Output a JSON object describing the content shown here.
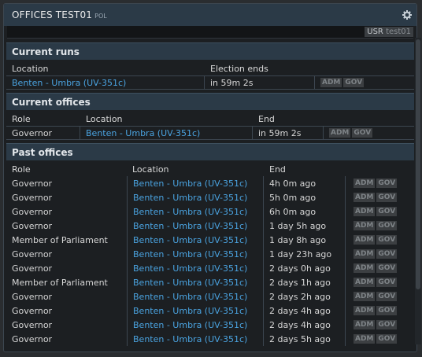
{
  "window": {
    "title": "OFFICES TEST01",
    "tag": "POL",
    "gear_icon": "gear-icon"
  },
  "user": {
    "label": "USR",
    "name": "test01"
  },
  "current_runs": {
    "title": "Current runs",
    "headers": {
      "location": "Location",
      "ends": "Election ends"
    },
    "rows": [
      {
        "location": "Benten - Umbra (UV-351c)",
        "ends": "in 59m 2s",
        "adm": "ADM",
        "gov": "GOV"
      }
    ]
  },
  "current_offices": {
    "title": "Current offices",
    "headers": {
      "role": "Role",
      "location": "Location",
      "end": "End"
    },
    "rows": [
      {
        "role": "Governor",
        "location": "Benten - Umbra (UV-351c)",
        "end": "in 59m 2s",
        "adm": "ADM",
        "gov": "GOV"
      }
    ]
  },
  "past_offices": {
    "title": "Past offices",
    "headers": {
      "role": "Role",
      "location": "Location",
      "end": "End"
    },
    "rows": [
      {
        "role": "Governor",
        "location": "Benten - Umbra (UV-351c)",
        "end": "4h 0m ago",
        "adm": "ADM",
        "gov": "GOV"
      },
      {
        "role": "Governor",
        "location": "Benten - Umbra (UV-351c)",
        "end": "5h 0m ago",
        "adm": "ADM",
        "gov": "GOV"
      },
      {
        "role": "Governor",
        "location": "Benten - Umbra (UV-351c)",
        "end": "6h 0m ago",
        "adm": "ADM",
        "gov": "GOV"
      },
      {
        "role": "Governor",
        "location": "Benten - Umbra (UV-351c)",
        "end": "1 day 5h ago",
        "adm": "ADM",
        "gov": "GOV"
      },
      {
        "role": "Member of Parliament",
        "location": "Benten - Umbra (UV-351c)",
        "end": "1 day 8h ago",
        "adm": "ADM",
        "gov": "GOV"
      },
      {
        "role": "Governor",
        "location": "Benten - Umbra (UV-351c)",
        "end": "1 day 23h ago",
        "adm": "ADM",
        "gov": "GOV"
      },
      {
        "role": "Governor",
        "location": "Benten - Umbra (UV-351c)",
        "end": "2 days 0h ago",
        "adm": "ADM",
        "gov": "GOV"
      },
      {
        "role": "Member of Parliament",
        "location": "Benten - Umbra (UV-351c)",
        "end": "2 days 1h ago",
        "adm": "ADM",
        "gov": "GOV"
      },
      {
        "role": "Governor",
        "location": "Benten - Umbra (UV-351c)",
        "end": "2 days 2h ago",
        "adm": "ADM",
        "gov": "GOV"
      },
      {
        "role": "Governor",
        "location": "Benten - Umbra (UV-351c)",
        "end": "2 days 4h ago",
        "adm": "ADM",
        "gov": "GOV"
      },
      {
        "role": "Governor",
        "location": "Benten - Umbra (UV-351c)",
        "end": "2 days 4h ago",
        "adm": "ADM",
        "gov": "GOV"
      },
      {
        "role": "Governor",
        "location": "Benten - Umbra (UV-351c)",
        "end": "2 days 5h ago",
        "adm": "ADM",
        "gov": "GOV"
      }
    ]
  }
}
